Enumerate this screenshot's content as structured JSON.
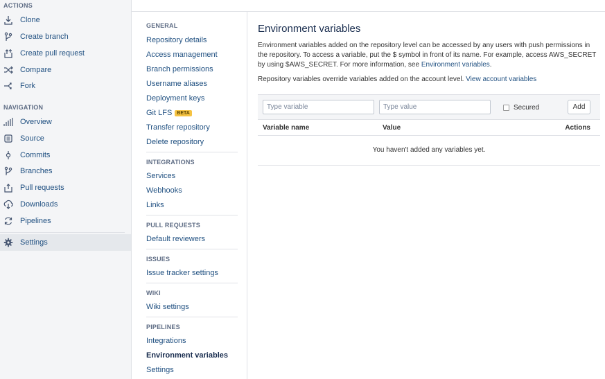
{
  "sidebar": {
    "actions_heading": "ACTIONS",
    "actions": [
      {
        "label": "Clone",
        "icon": "download-icon"
      },
      {
        "label": "Create branch",
        "icon": "branch-icon"
      },
      {
        "label": "Create pull request",
        "icon": "pull-request-icon"
      },
      {
        "label": "Compare",
        "icon": "compare-icon"
      },
      {
        "label": "Fork",
        "icon": "fork-icon"
      }
    ],
    "navigation_heading": "NAVIGATION",
    "navigation": [
      {
        "label": "Overview",
        "icon": "overview-icon"
      },
      {
        "label": "Source",
        "icon": "source-icon"
      },
      {
        "label": "Commits",
        "icon": "commits-icon"
      },
      {
        "label": "Branches",
        "icon": "branches-icon"
      },
      {
        "label": "Pull requests",
        "icon": "pull-requests-icon"
      },
      {
        "label": "Downloads",
        "icon": "downloads-icon"
      },
      {
        "label": "Pipelines",
        "icon": "pipelines-icon"
      }
    ],
    "settings": {
      "label": "Settings",
      "icon": "gear-icon",
      "active": true
    }
  },
  "menu": {
    "general_heading": "GENERAL",
    "general": [
      "Repository details",
      "Access management",
      "Branch permissions",
      "Username aliases",
      "Deployment keys",
      "Git LFS",
      "Transfer repository",
      "Delete repository"
    ],
    "beta_badge": "BETA",
    "integrations_heading": "INTEGRATIONS",
    "integrations": [
      "Services",
      "Webhooks",
      "Links"
    ],
    "pull_requests_heading": "PULL REQUESTS",
    "pull_requests": [
      "Default reviewers"
    ],
    "issues_heading": "ISSUES",
    "issues": [
      "Issue tracker settings"
    ],
    "wiki_heading": "WIKI",
    "wiki": [
      "Wiki settings"
    ],
    "pipelines_heading": "PIPELINES",
    "pipelines": [
      "Integrations",
      "Environment variables",
      "Settings"
    ],
    "current": "Environment variables"
  },
  "main": {
    "title": "Environment variables",
    "description_1": "Environment variables added on the repository level can be accessed by any users with push permissions in the repository. To access a variable, put the $ symbol in front of its name. For example, access AWS_SECRET by using $AWS_SECRET. For more information, see ",
    "description_1_link": "Environment variables",
    "description_1_end": ".",
    "description_2": "Repository variables override variables added on the account level. ",
    "description_2_link": "View account variables",
    "form": {
      "variable_placeholder": "Type variable",
      "value_placeholder": "Type value",
      "secured_label": "Secured",
      "secured_checked": false,
      "add_label": "Add"
    },
    "table": {
      "columns": [
        "Variable name",
        "Value",
        "Actions"
      ],
      "empty_message": "You haven't added any variables yet."
    }
  },
  "colors": {
    "link": "#205081",
    "sidebar_bg": "#f4f5f7",
    "badge_bg": "#f6c342"
  }
}
